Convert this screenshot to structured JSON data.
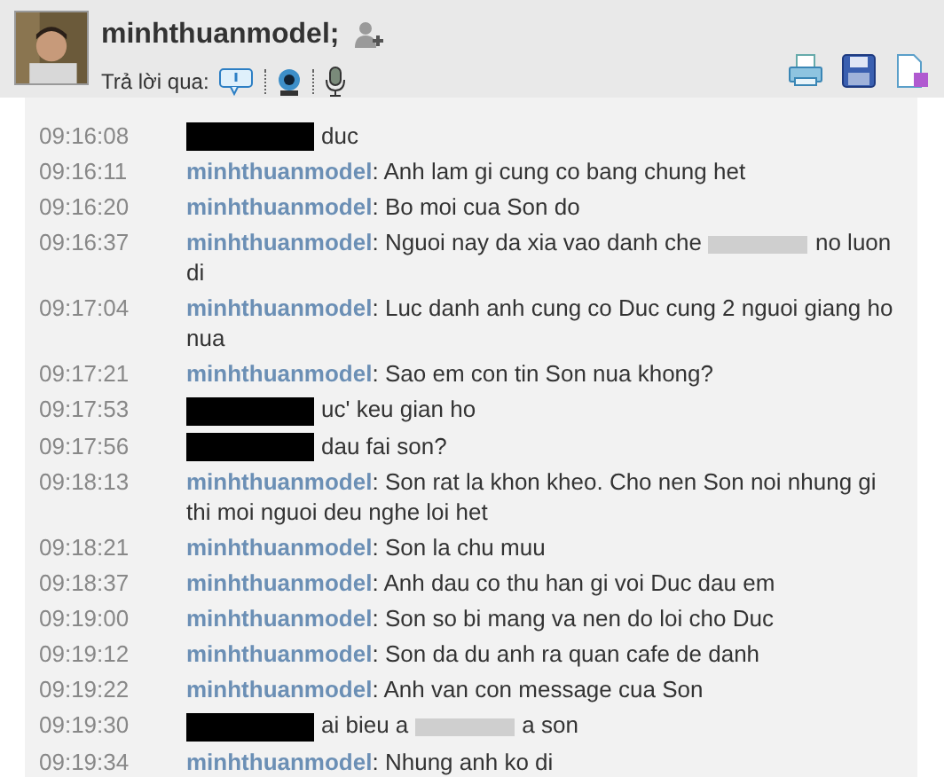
{
  "header": {
    "name": "minhthuanmodel;",
    "reply_label": "Trả lời qua:"
  },
  "messages": [
    {
      "time": "09:16:08",
      "parts": [
        {
          "kind": "redact"
        },
        {
          "kind": "text",
          "text": "duc"
        }
      ]
    },
    {
      "time": "09:16:11",
      "sender": "minhthuanmodel",
      "sender_sep": ":",
      "parts": [
        {
          "kind": "text",
          "text": "Anh lam gi cung co bang chung het"
        }
      ]
    },
    {
      "time": "09:16:20",
      "sender": "minhthuanmodel",
      "sender_sep": ":",
      "parts": [
        {
          "kind": "text",
          "text": "Bo moi cua Son do"
        }
      ]
    },
    {
      "time": "09:16:37",
      "sender": "minhthuanmodel",
      "sender_sep": ":",
      "parts": [
        {
          "kind": "text",
          "text": "Nguoi nay da xia vao danh che"
        },
        {
          "kind": "blur"
        },
        {
          "kind": "text",
          "text": "no luon di"
        }
      ]
    },
    {
      "time": "09:17:04",
      "sender": "minhthuanmodel",
      "sender_sep": ":",
      "parts": [
        {
          "kind": "text",
          "text": "Luc danh anh cung co Duc cung 2 nguoi giang ho nua"
        }
      ]
    },
    {
      "time": "09:17:21",
      "sender": "minhthuanmodel",
      "sender_sep": ":",
      "parts": [
        {
          "kind": "text",
          "text": "Sao em con tin Son nua khong?"
        }
      ]
    },
    {
      "time": "09:17:53",
      "parts": [
        {
          "kind": "redact"
        },
        {
          "kind": "text",
          "text": "uc' keu gian ho"
        }
      ]
    },
    {
      "time": "09:17:56",
      "parts": [
        {
          "kind": "redact"
        },
        {
          "kind": "text",
          "text": "dau fai son?"
        }
      ]
    },
    {
      "time": "09:18:13",
      "sender": "minhthuanmodel",
      "sender_sep": ":",
      "parts": [
        {
          "kind": "text",
          "text": "Son rat la khon kheo. Cho nen Son noi nhung gi thi moi nguoi deu nghe loi het"
        }
      ]
    },
    {
      "time": "09:18:21",
      "sender": "minhthuanmodel",
      "sender_sep": ":",
      "parts": [
        {
          "kind": "text",
          "text": "Son la chu muu"
        }
      ]
    },
    {
      "time": "09:18:37",
      "sender": "minhthuanmodel",
      "sender_sep": ":",
      "parts": [
        {
          "kind": "text",
          "text": "Anh dau co thu han gi voi Duc dau em"
        }
      ]
    },
    {
      "time": "09:19:00",
      "sender": "minhthuanmodel",
      "sender_sep": ":",
      "parts": [
        {
          "kind": "text",
          "text": "Son so bi mang va nen do loi cho Duc"
        }
      ]
    },
    {
      "time": "09:19:12",
      "sender": "minhthuanmodel",
      "sender_sep": ":",
      "parts": [
        {
          "kind": "text",
          "text": "Son da du anh ra quan cafe de danh"
        }
      ]
    },
    {
      "time": "09:19:22",
      "sender": "minhthuanmodel",
      "sender_sep": ":",
      "parts": [
        {
          "kind": "text",
          "text": "Anh van con message cua Son"
        }
      ]
    },
    {
      "time": "09:19:30",
      "parts": [
        {
          "kind": "redact"
        },
        {
          "kind": "text",
          "text": "ai bieu a"
        },
        {
          "kind": "blur"
        },
        {
          "kind": "text",
          "text": "a son"
        }
      ]
    },
    {
      "time": "09:19:34",
      "sender": "minhthuanmodel",
      "sender_sep": ":",
      "parts": [
        {
          "kind": "text",
          "text": "Nhung anh ko di"
        }
      ]
    }
  ]
}
